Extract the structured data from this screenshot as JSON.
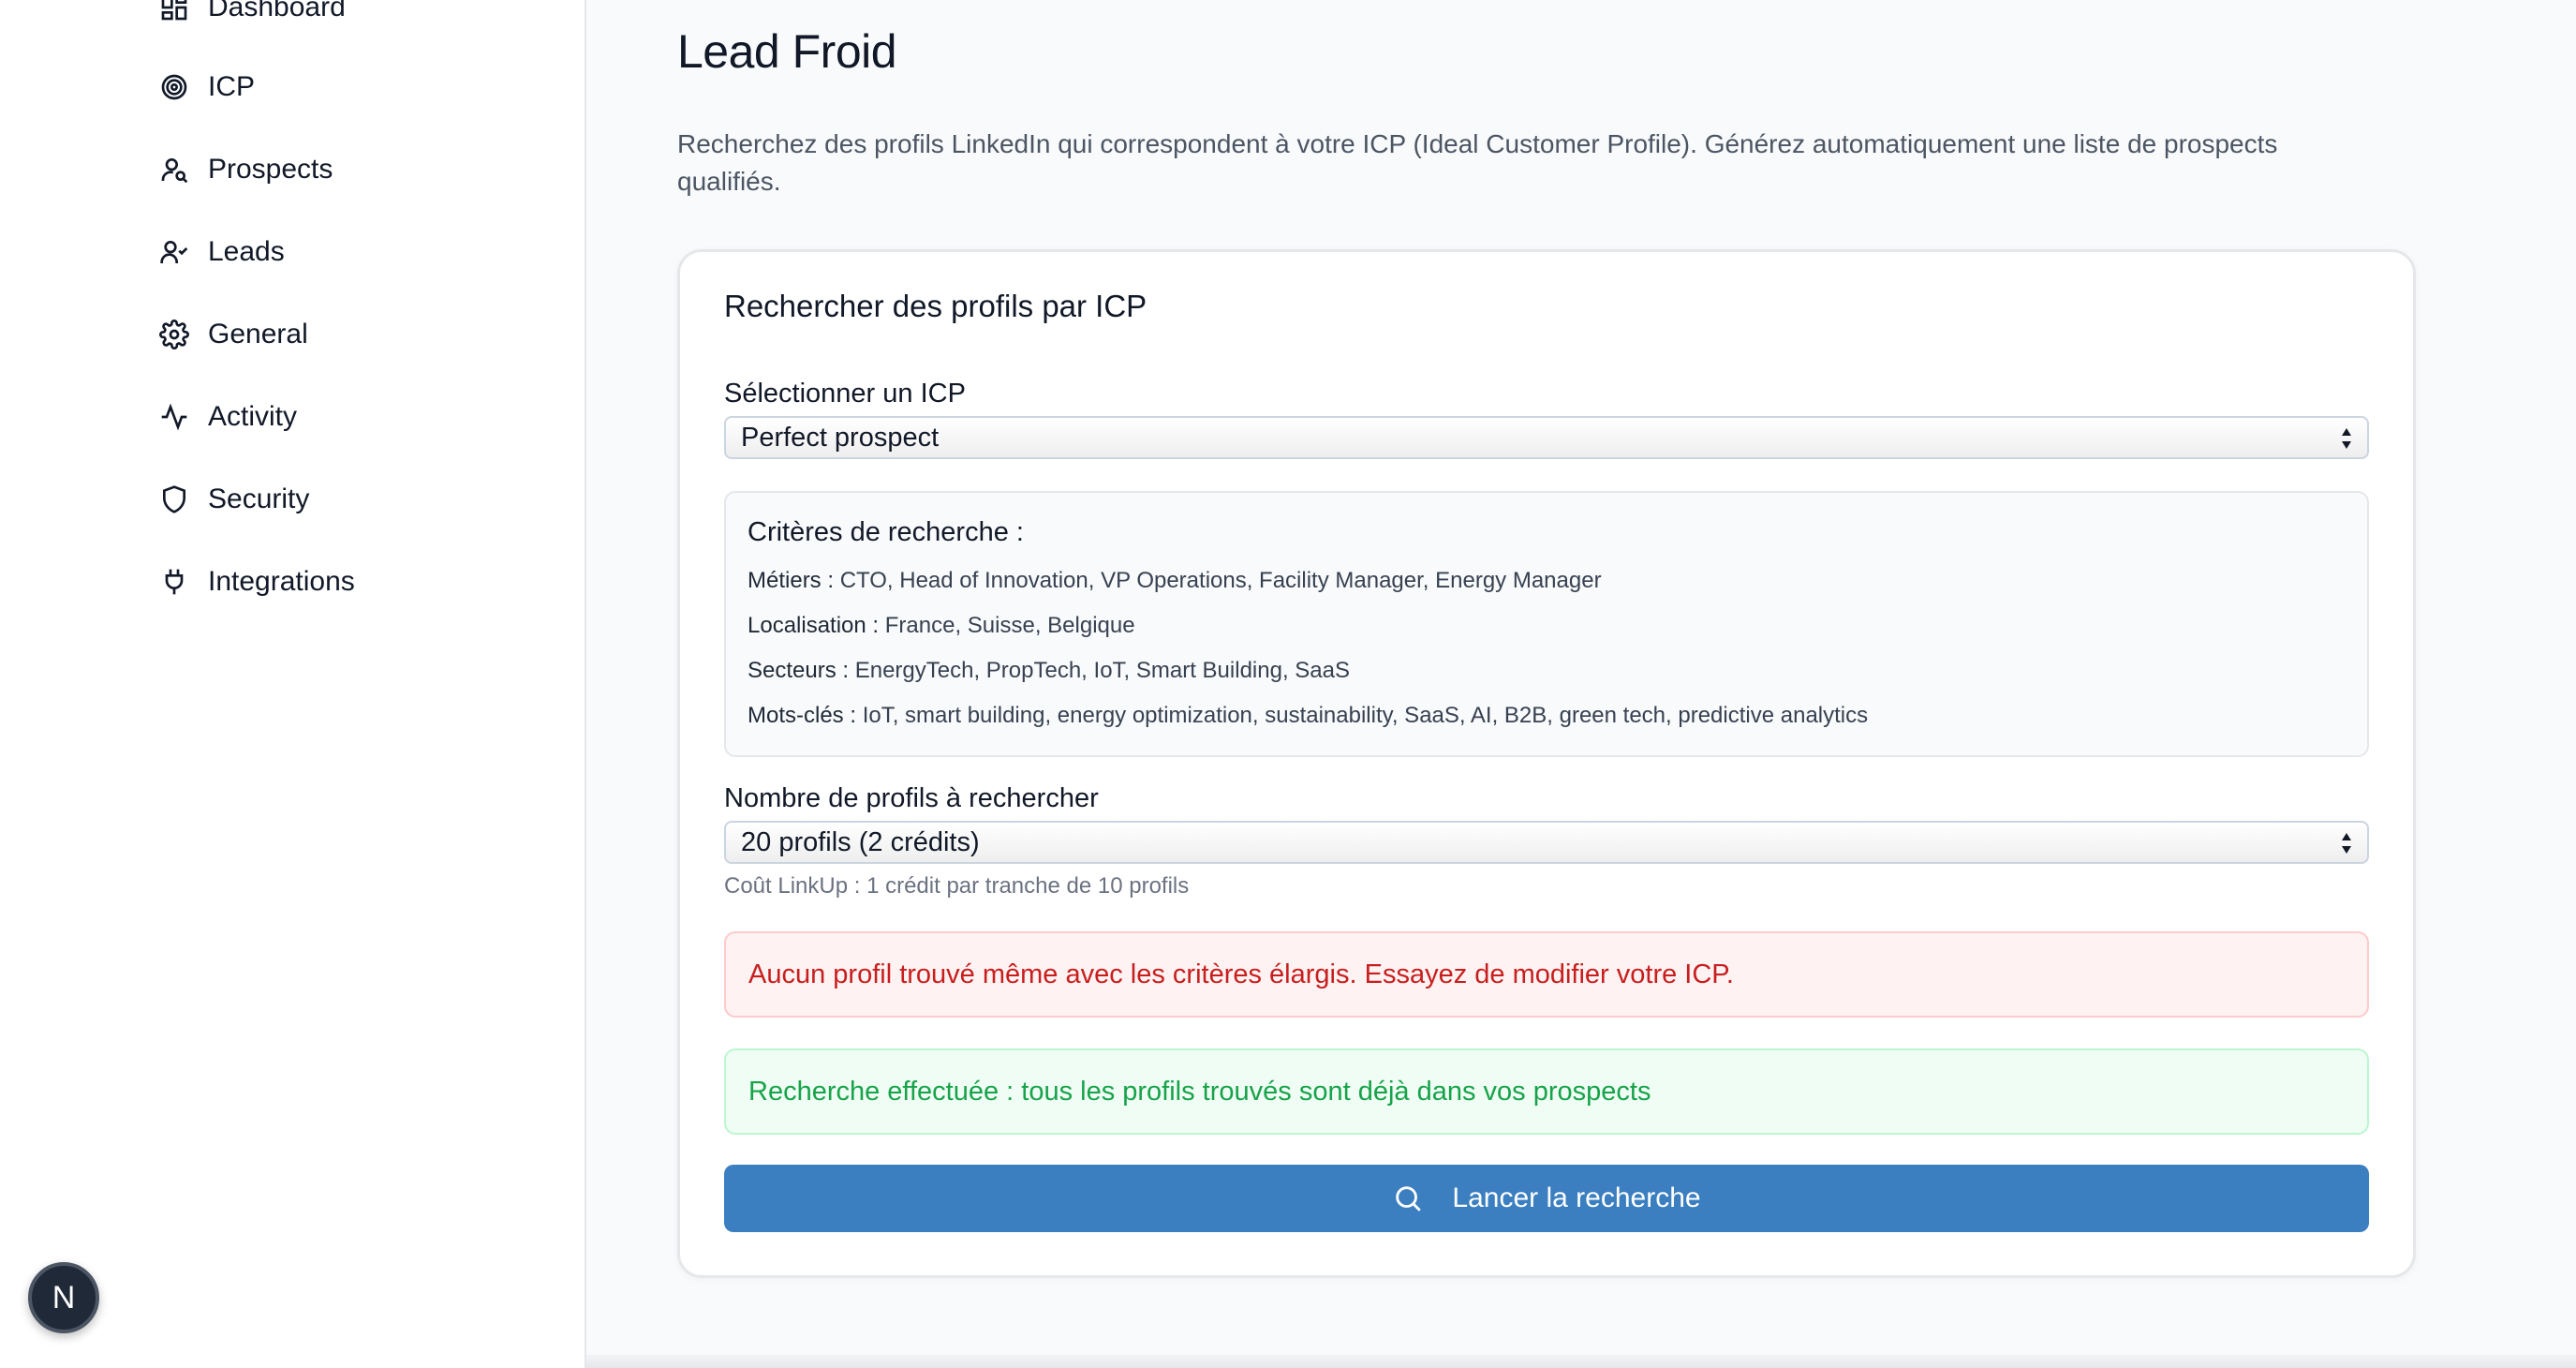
{
  "sidebar": {
    "items": [
      {
        "label": "Dashboard",
        "icon": "dashboard-icon"
      },
      {
        "label": "ICP",
        "icon": "target-icon"
      },
      {
        "label": "Prospects",
        "icon": "user-search-icon"
      },
      {
        "label": "Leads",
        "icon": "user-check-icon"
      },
      {
        "label": "General",
        "icon": "gear-icon"
      },
      {
        "label": "Activity",
        "icon": "activity-icon"
      },
      {
        "label": "Security",
        "icon": "shield-icon"
      },
      {
        "label": "Integrations",
        "icon": "plug-icon"
      }
    ]
  },
  "badge": {
    "letter": "N"
  },
  "page": {
    "title": "Lead Froid",
    "description": "Recherchez des profils LinkedIn qui correspondent à votre ICP (Ideal Customer Profile). Générez automatiquement une liste de prospects qualifiés."
  },
  "card": {
    "title": "Rechercher des profils par ICP",
    "icp_label": "Sélectionner un ICP",
    "icp_selected": "Perfect prospect",
    "criteria": {
      "title": "Critères de recherche :",
      "lines": [
        {
          "key": "Métiers :",
          "value": "CTO, Head of Innovation, VP Operations, Facility Manager, Energy Manager"
        },
        {
          "key": "Localisation :",
          "value": "France, Suisse, Belgique"
        },
        {
          "key": "Secteurs :",
          "value": "EnergyTech, PropTech, IoT, Smart Building, SaaS"
        },
        {
          "key": "Mots-clés :",
          "value": "IoT, smart building, energy optimization, sustainability, SaaS, AI, B2B, green tech, predictive analytics"
        }
      ]
    },
    "count_label": "Nombre de profils à rechercher",
    "count_selected": "20 profils (2 crédits)",
    "cost_hint": "Coût LinkUp : 1 crédit par tranche de 10 profils",
    "error_message": "Aucun profil trouvé même avec les critères élargis. Essayez de modifier votre ICP.",
    "success_message": "Recherche effectuée : tous les profils trouvés sont déjà dans vos prospects",
    "search_button": "Lancer la recherche"
  },
  "colors": {
    "primary": "#3b7fc0",
    "error_text": "#c81e1e",
    "success_text": "#16a34a"
  }
}
